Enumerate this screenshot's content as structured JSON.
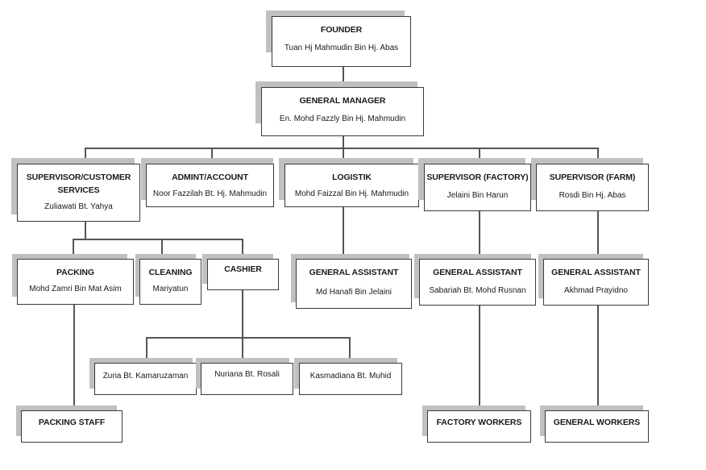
{
  "diagram": {
    "type": "org-chart",
    "nodes": {
      "founder": {
        "title": "FOUNDER",
        "name": "Tuan Hj Mahmudin Bin Hj. Abas"
      },
      "general_manager": {
        "title": "GENERAL MANAGER",
        "name": "En. Mohd Fazzly Bin Hj. Mahmudin"
      },
      "supervisor_cs": {
        "title": "SUPERVISOR/CUSTOMER SERVICES",
        "name": "Zuliawati Bt. Yahya"
      },
      "admin_account": {
        "title": "ADMINT/ACCOUNT",
        "name": "Noor Fazzilah Bt. Hj. Mahmudin"
      },
      "logistik": {
        "title": "LOGISTIK",
        "name": "Mohd Faizzal Bin Hj. Mahmudin"
      },
      "supervisor_factory": {
        "title": "SUPERVISOR (FACTORY)",
        "name": "Jelaini Bin Harun"
      },
      "supervisor_farm": {
        "title": "SUPERVISOR (FARM)",
        "name": "Rosdi Bin Hj. Abas"
      },
      "packing": {
        "title": "PACKING",
        "name": "Mohd Zamri Bin Mat Asim"
      },
      "cleaning": {
        "title": "CLEANING",
        "name": "Mariyatun"
      },
      "cashier": {
        "title": "CASHIER"
      },
      "ga_logistik": {
        "title": "GENERAL ASSISTANT",
        "name": "Md Hanafi Bin Jelaini"
      },
      "ga_factory": {
        "title": "GENERAL ASSISTANT",
        "name": "Sabariah Bt. Mohd Rusnan"
      },
      "ga_farm": {
        "title": "GENERAL ASSISTANT",
        "name": "Akhmad Prayidno"
      },
      "cashier_1": {
        "name": "Zuria Bt. Kamaruzaman"
      },
      "cashier_2": {
        "name": "Nuriana Bt. Rosali"
      },
      "cashier_3": {
        "name": "Kasmadiana Bt. Muhid"
      },
      "packing_staff": {
        "title": "PACKING STAFF"
      },
      "factory_workers": {
        "title": "FACTORY WORKERS"
      },
      "general_workers": {
        "title": "GENERAL WORKERS"
      }
    },
    "edges": [
      [
        "founder",
        "general_manager"
      ],
      [
        "general_manager",
        "supervisor_cs"
      ],
      [
        "general_manager",
        "admin_account"
      ],
      [
        "general_manager",
        "logistik"
      ],
      [
        "general_manager",
        "supervisor_factory"
      ],
      [
        "general_manager",
        "supervisor_farm"
      ],
      [
        "supervisor_cs",
        "packing"
      ],
      [
        "supervisor_cs",
        "cleaning"
      ],
      [
        "supervisor_cs",
        "cashier"
      ],
      [
        "logistik",
        "ga_logistik"
      ],
      [
        "supervisor_factory",
        "ga_factory"
      ],
      [
        "supervisor_farm",
        "ga_farm"
      ],
      [
        "cashier",
        "cashier_1"
      ],
      [
        "cashier",
        "cashier_2"
      ],
      [
        "cashier",
        "cashier_3"
      ],
      [
        "packing",
        "packing_staff"
      ],
      [
        "ga_factory",
        "factory_workers"
      ],
      [
        "ga_farm",
        "general_workers"
      ]
    ]
  }
}
